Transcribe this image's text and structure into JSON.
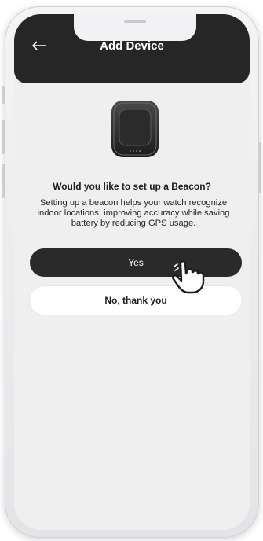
{
  "header": {
    "title": "Add Device",
    "back_icon": "arrow-left-icon"
  },
  "device": {
    "image_icon": "beacon-device-icon"
  },
  "prompt": {
    "question": "Would you like to set up a Beacon?",
    "description": "Setting up a beacon helps your watch recognize indoor locations, improving accuracy while saving battery by reducing GPS usage."
  },
  "actions": {
    "yes_label": "Yes",
    "no_label": "No, thank you"
  },
  "overlay": {
    "pointer_icon": "hand-pointer-icon"
  },
  "colors": {
    "header_bg": "#262626",
    "screen_bg": "#efefef",
    "primary_button": "#2a2a2a",
    "secondary_button": "#ffffff"
  }
}
